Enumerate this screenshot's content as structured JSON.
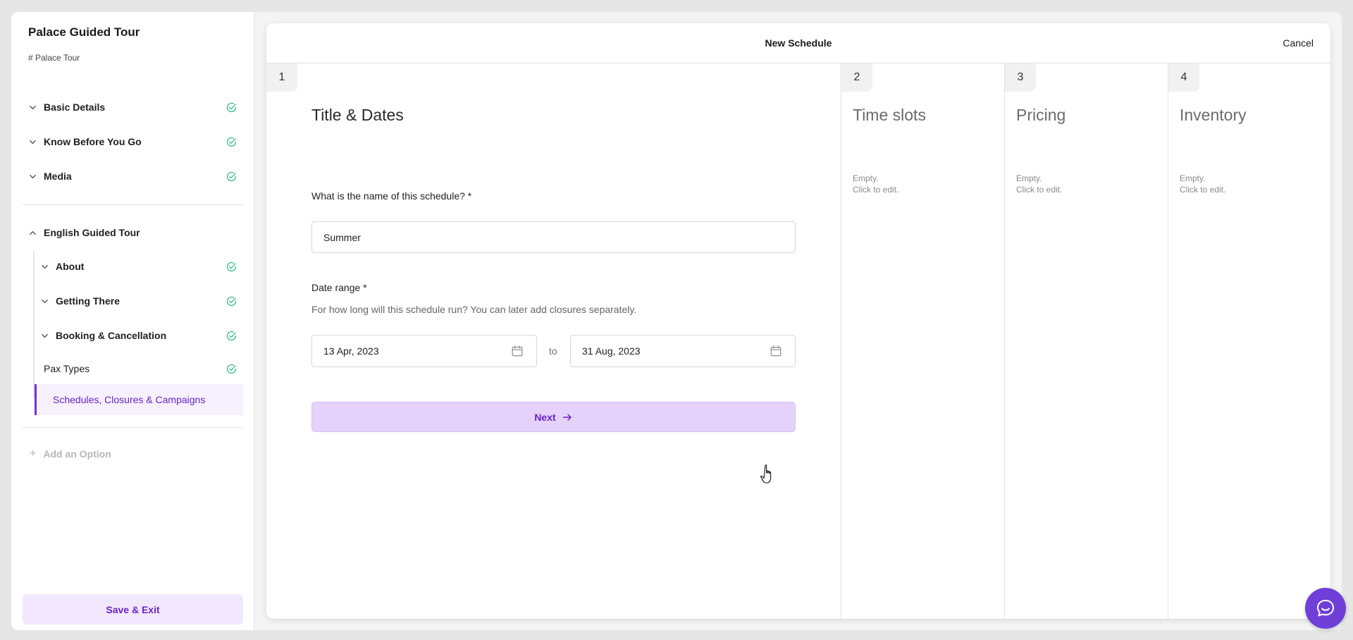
{
  "sidebar": {
    "title": "Palace Guided Tour",
    "subtitle": "# Palace Tour",
    "sections": [
      {
        "label": "Basic Details"
      },
      {
        "label": "Know Before You Go"
      },
      {
        "label": "Media"
      }
    ],
    "option": {
      "label": "English Guided Tour",
      "items": [
        {
          "label": "About"
        },
        {
          "label": "Getting There"
        },
        {
          "label": "Booking & Cancellation"
        },
        {
          "label": "Pax Types"
        }
      ],
      "active_item": "Schedules, Closures & Campaigns"
    },
    "add_option_label": "Add an Option",
    "save_label": "Save & Exit"
  },
  "modal": {
    "title": "New Schedule",
    "cancel_label": "Cancel",
    "steps": [
      {
        "number": "1",
        "title": "Title & Dates"
      },
      {
        "number": "2",
        "title": "Time slots",
        "empty_line1": "Empty.",
        "empty_line2": "Click to edit."
      },
      {
        "number": "3",
        "title": "Pricing",
        "empty_line1": "Empty.",
        "empty_line2": "Click to edit."
      },
      {
        "number": "4",
        "title": "Inventory",
        "empty_line1": "Empty.",
        "empty_line2": "Click to edit."
      }
    ],
    "form": {
      "name_label": "What is the name of this schedule? *",
      "name_value": "Summer",
      "date_label": "Date range *",
      "date_help": "For how long will this schedule run? You can later add closures separately.",
      "start_date": "13 Apr, 2023",
      "to_label": "to",
      "end_date": "31 Aug, 2023",
      "next_label": "Next"
    }
  },
  "colors": {
    "accent": "#6a22c6",
    "accent_light": "#f1e8fd",
    "success": "#3fbf8a",
    "chat": "#6f3fd8"
  },
  "icons": {
    "section_chevron": "chevron-down-icon",
    "option_chevron": "chevron-up-icon",
    "complete": "check-circle-icon",
    "add": "plus-icon",
    "calendar": "calendar-icon",
    "next": "arrow-right-icon",
    "chat": "chat-icon"
  }
}
